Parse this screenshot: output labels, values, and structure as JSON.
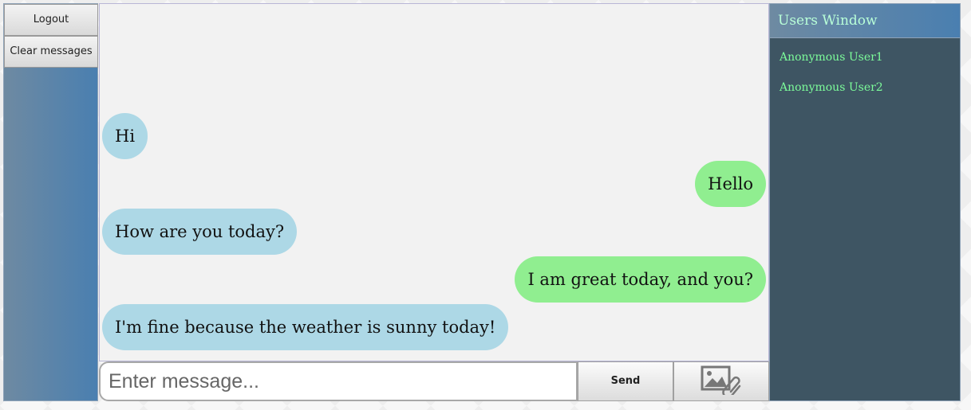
{
  "sidebar": {
    "logout_label": "Logout",
    "clear_label": "Clear messages"
  },
  "chat": {
    "messages": [
      {
        "side": "left",
        "text": "Hi"
      },
      {
        "side": "right",
        "text": "Hello"
      },
      {
        "side": "left",
        "text": "How are you today?"
      },
      {
        "side": "right",
        "text": "I am great today, and you?"
      },
      {
        "side": "left",
        "text": "I'm fine because the weather is sunny today!"
      }
    ]
  },
  "input_bar": {
    "placeholder": "Enter message...",
    "value": "",
    "send_label": "Send",
    "attach_icon": "image-attachment-icon"
  },
  "users_window": {
    "title": "Users Window",
    "users": [
      "Anonymous User1",
      "Anonymous User2"
    ]
  },
  "colors": {
    "incoming_bubble": "#add8e6",
    "outgoing_bubble": "#90ee90",
    "users_panel_bg": "#3e5563",
    "user_name": "#7cfc9a"
  }
}
